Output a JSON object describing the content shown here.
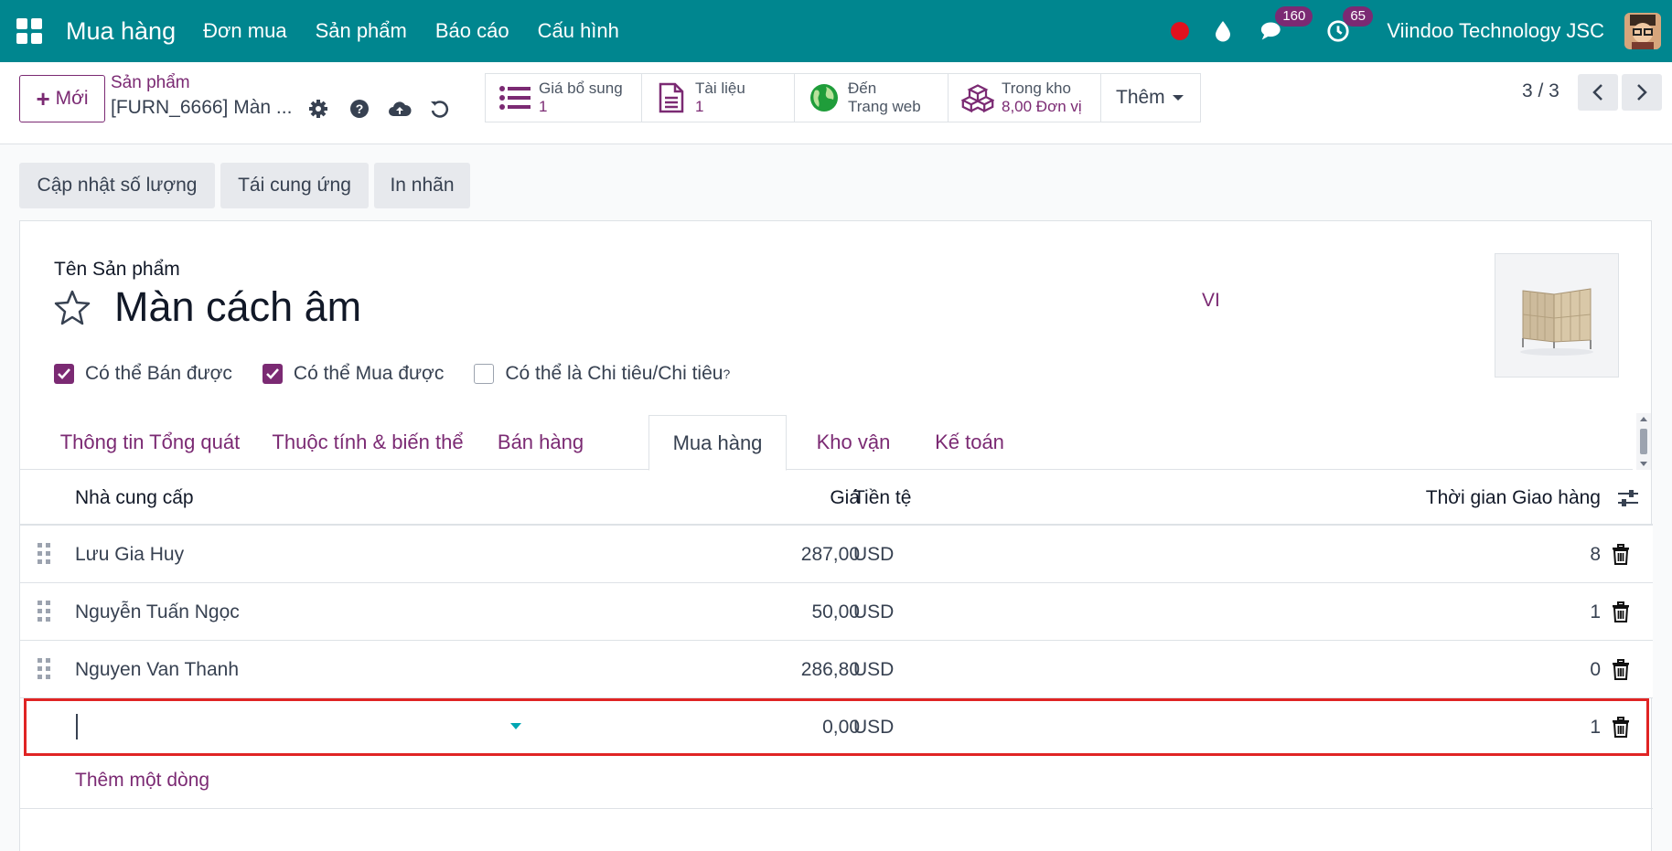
{
  "navbar": {
    "brand": "Mua hàng",
    "menu": [
      "Đơn mua",
      "Sản phẩm",
      "Báo cáo",
      "Cấu hình"
    ],
    "chat_count": "160",
    "activity_count": "65",
    "company": "Viindoo Technology JSC"
  },
  "control": {
    "new_label": "Mới",
    "breadcrumb_parent": "Sản phẩm",
    "breadcrumb_current": "[FURN_6666] Màn ...",
    "smart_buttons": {
      "pricelist_title": "Giá bổ sung",
      "pricelist_value": "1",
      "documents_title": "Tài liệu",
      "documents_value": "1",
      "website_title": "Đến",
      "website_value": "Trang web",
      "stock_title": "Trong kho",
      "stock_value": "8,00 Đơn vị",
      "more_label": "Thêm"
    },
    "pager": "3 / 3"
  },
  "status_buttons": [
    "Cập nhật số lượng",
    "Tái cung ứng",
    "In nhãn"
  ],
  "form": {
    "name_label": "Tên Sản phẩm",
    "product_name": "Màn cách âm",
    "lang": "VI",
    "checkboxes": [
      {
        "label": "Có thể Bán được",
        "checked": true
      },
      {
        "label": "Có thể Mua được",
        "checked": true
      },
      {
        "label": "Có thể là Chi tiêu/Chi tiêu",
        "checked": false,
        "tooltip_mark": "?"
      }
    ],
    "tabs": [
      "Thông tin Tổng quát",
      "Thuộc tính & biến thể",
      "Bán hàng",
      "Mua hàng",
      "Kho vận",
      "Kế toán"
    ],
    "active_tab": "Mua hàng"
  },
  "table": {
    "headers": {
      "vendor": "Nhà cung cấp",
      "price": "Giá",
      "currency": "Tiền tệ",
      "lead_time": "Thời gian Giao hàng"
    },
    "rows": [
      {
        "vendor": "Lưu Gia Huy",
        "price": "287,00",
        "currency": "USD",
        "lead_time": "8"
      },
      {
        "vendor": "Nguyễn Tuấn Ngọc",
        "price": "50,00",
        "currency": "USD",
        "lead_time": "1"
      },
      {
        "vendor": "Nguyen Van Thanh",
        "price": "286,80",
        "currency": "USD",
        "lead_time": "0"
      }
    ],
    "editing_row": {
      "vendor": "",
      "price": "0,00",
      "currency": "USD",
      "lead_time": "1"
    },
    "add_line": "Thêm một dòng"
  },
  "colors": {
    "navbar": "#00868f",
    "accent": "#7b2a73",
    "highlight": "#e02424"
  }
}
